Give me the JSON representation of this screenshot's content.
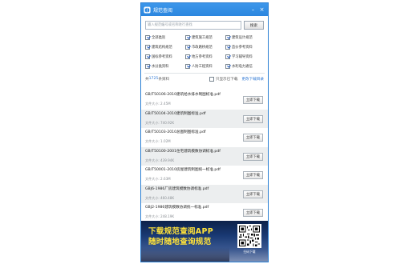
{
  "app": {
    "title": "规范查阅",
    "minimize_glyph": "–",
    "close_glyph": "×"
  },
  "search": {
    "placeholder": "输入规范编号或名称进行查找",
    "button": "搜索"
  },
  "categories": [
    {
      "label": "全部类别",
      "checked": true
    },
    {
      "label": "建筑施工规范",
      "checked": true
    },
    {
      "label": "建筑设计规范",
      "checked": true
    },
    {
      "label": "建筑结构规范",
      "checked": true
    },
    {
      "label": "市政路桥规范",
      "checked": true
    },
    {
      "label": "造价参考资料",
      "checked": true
    },
    {
      "label": "国标参考资料",
      "checked": true
    },
    {
      "label": "地方参考资料",
      "checked": true
    },
    {
      "label": "学习辅导资料",
      "checked": true
    },
    {
      "label": "水分类资料",
      "checked": true
    },
    {
      "label": "人防工程资料",
      "checked": true
    },
    {
      "label": "水利电力通信",
      "checked": true
    }
  ],
  "status": {
    "prefix": "共",
    "count": "1725",
    "suffix": "条资料",
    "only_downloaded": "只显示已下载",
    "open_dir": "更改下载目录"
  },
  "files": [
    {
      "name": "GB/T50106-2010建筑给水排水制图标准.pdf",
      "size": "文件大小: 2.45M",
      "action": "立即下载"
    },
    {
      "name": "GB/T50104-2010建筑制图标准.pdf",
      "size": "文件大小: 740.92K",
      "action": "立即下载"
    },
    {
      "name": "GB/T50103-2010总图制图标准.pdf",
      "size": "文件大小: 1.02M",
      "action": "立即下载"
    },
    {
      "name": "GB/T50100-2001住宅建筑模数协调标准.pdf",
      "size": "文件大小: 439.94K",
      "action": "立即下载"
    },
    {
      "name": "GB/T50001-2010房屋建筑制图统一标准.pdf",
      "size": "文件大小: 2.63M",
      "action": "立即下载"
    },
    {
      "name": "GBJ6-1986厂房建筑模数协调标准.pdf",
      "size": "文件大小: 460.48K",
      "action": "立即下载"
    },
    {
      "name": "GBJ2-1986建筑模数协调统一标准.pdf",
      "size": "文件大小: 248.19K",
      "action": "立即下载"
    }
  ],
  "banner": {
    "line1": "下载规范查阅APP",
    "line2": "随时随地查询规范",
    "qr_caption": "扫码下载"
  }
}
